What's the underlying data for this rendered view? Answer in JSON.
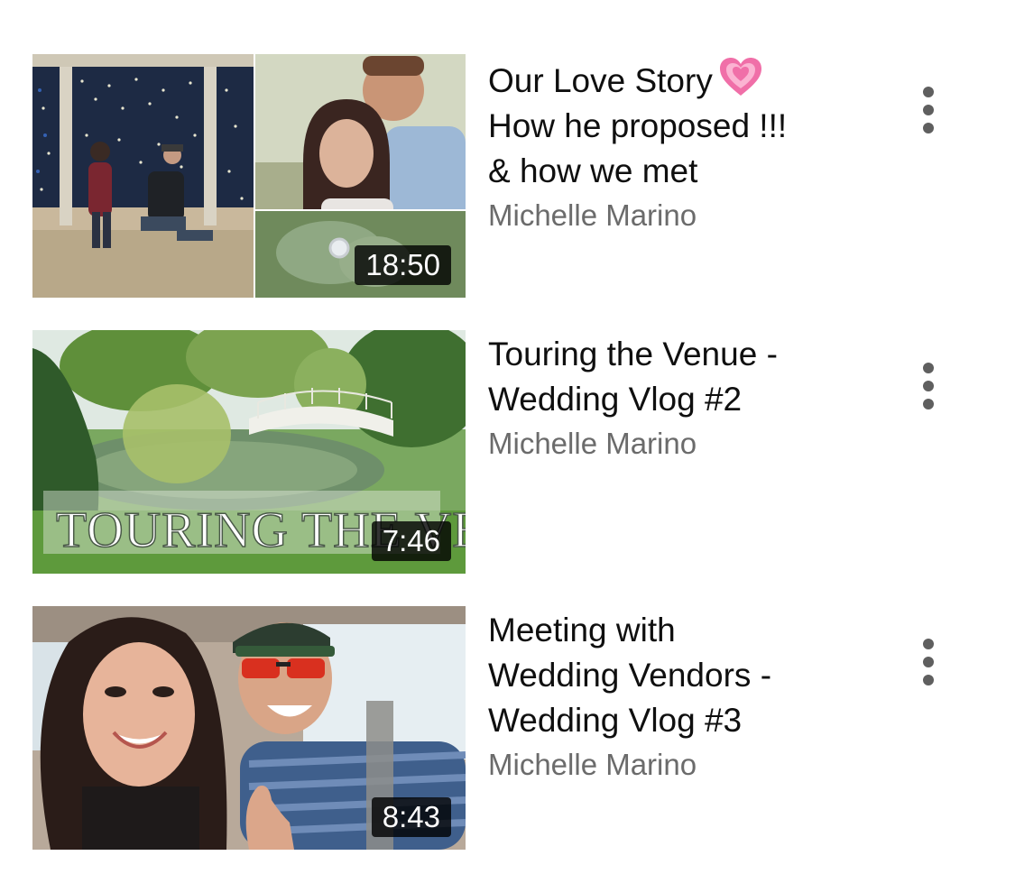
{
  "videos": [
    {
      "title": "Our Love Story\nHow he proposed !!!\n& how we met",
      "title_line1": "Our Love Story",
      "title_rest": "How he proposed !!!\n& how we met",
      "title_icon": "pink-hearts-emoji",
      "channel": "Michelle Marino",
      "duration": "18:50",
      "menu_icon": "more-vert-icon"
    },
    {
      "title": "Touring the Venue -\nWedding Vlog #2",
      "channel": "Michelle Marino",
      "duration": "7:46",
      "thumbnail_overlay": "TOURING THE VE",
      "menu_icon": "more-vert-icon"
    },
    {
      "title": "Meeting with\nWedding Vendors -\nWedding Vlog #3",
      "channel": "Michelle Marino",
      "duration": "8:43",
      "menu_icon": "more-vert-icon"
    }
  ],
  "colors": {
    "title": "#0f0f0f",
    "channel": "#6b6b6b",
    "menu_dots": "#5f5f5f",
    "heart": "#f06fa8",
    "duration_bg": "rgba(0,0,0,0.8)"
  }
}
